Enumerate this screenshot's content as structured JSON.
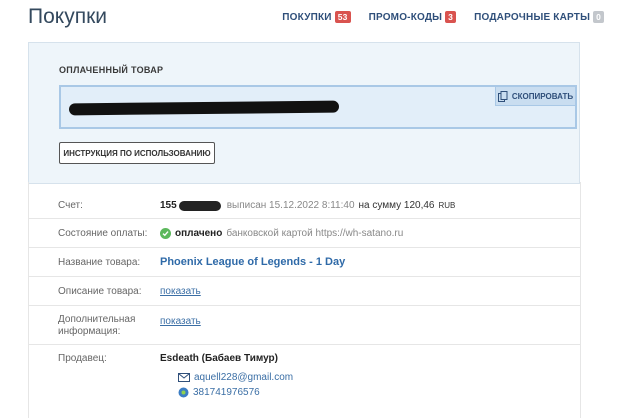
{
  "page": {
    "title": "Покупки"
  },
  "nav": [
    {
      "label": "ПОКУПКИ",
      "count": "53",
      "badge_color": "#d9534f"
    },
    {
      "label": "ПРОМО-КОДЫ",
      "count": "3",
      "badge_color": "#d9534f"
    },
    {
      "label": "ПОДАРОЧНЫЕ КАРТЫ",
      "count": "0",
      "badge_color": "#c3c7cc"
    }
  ],
  "product_panel": {
    "title": "ОПЛАЧЕННЫЙ ТОВАР",
    "copy_label": "СКОПИРОВАТЬ",
    "instructions_label": "ИНСТРУКЦИЯ ПО ИСПОЛЬЗОВАНИЮ"
  },
  "details": {
    "invoice": {
      "label": "Счет:",
      "number_prefix": "155",
      "issued_text": "выписан 15.12.2022 8:11:40",
      "sum_text": "на сумму 120,46",
      "currency": "RUB"
    },
    "payment": {
      "label": "Состояние оплаты:",
      "status": "оплачено",
      "method": "банковской картой https://wh-satano.ru"
    },
    "product_name": {
      "label": "Название товара:",
      "value": "Phoenix League of Legends - 1 Day"
    },
    "description": {
      "label": "Описание товара:",
      "link": "показать"
    },
    "additional": {
      "label_line1": "Дополнительная",
      "label_line2": "информация:",
      "link": "показать"
    },
    "seller": {
      "label": "Продавец:",
      "name": "Esdeath (Бабаев Тимур)",
      "email": "aquell228@gmail.com",
      "icq": "381741976576"
    }
  }
}
